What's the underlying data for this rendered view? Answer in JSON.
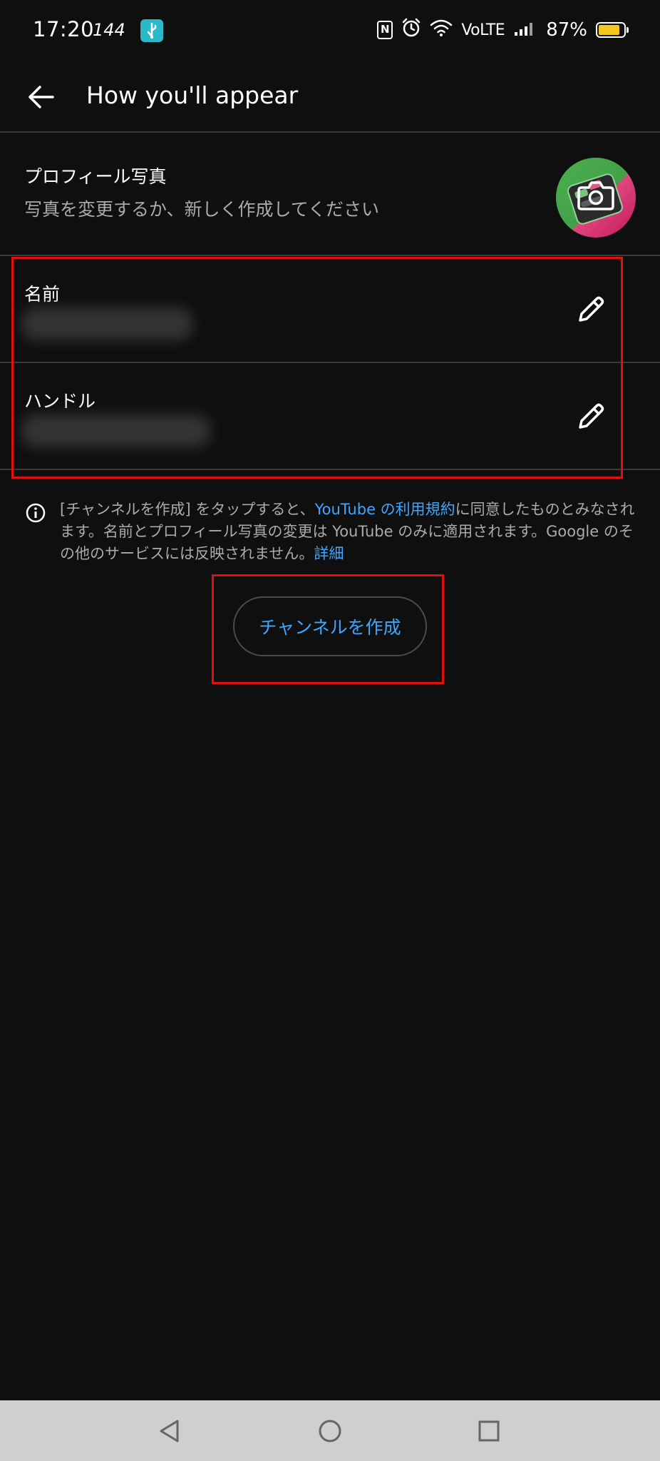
{
  "status_bar": {
    "time": "17:20",
    "refresh_rate": "144",
    "network": "VoLTE",
    "battery_percent": "87%",
    "battery_level": 0.87,
    "icons": [
      "usb-debug-icon",
      "nfc-icon",
      "alarm-icon",
      "wifi-icon",
      "signal-icon",
      "battery-charging-icon"
    ]
  },
  "app_bar": {
    "title": "How you'll appear",
    "back_icon": "arrow-left-icon"
  },
  "profile_photo": {
    "title": "プロフィール写真",
    "subtitle": "写真を変更するか、新しく作成してください",
    "icon": "camera-icon"
  },
  "fields": {
    "name": {
      "label": "名前",
      "value": "",
      "edit_icon": "pencil-icon"
    },
    "handle": {
      "label": "ハンドル",
      "value": "",
      "edit_icon": "pencil-icon"
    }
  },
  "info": {
    "icon": "info-icon",
    "text_before": "[チャンネルを作成] をタップすると、",
    "terms_link": "YouTube の利用規約",
    "text_after": "に同意したものとみなされます。名前とプロフィール写真の変更は YouTube のみに適用されます。Google のその他のサービスには反映されません。",
    "details_link": "詳細"
  },
  "create_button": {
    "label": "チャンネルを作成"
  },
  "nav_bar": {
    "icons": [
      "nav-back-icon",
      "nav-home-icon",
      "nav-recents-icon"
    ]
  },
  "colors": {
    "background": "#0f0f0f",
    "link": "#3ea6ff",
    "secondary_text": "#aaaaaa",
    "divider": "#3a3a3a",
    "annotation": "#e01010"
  }
}
